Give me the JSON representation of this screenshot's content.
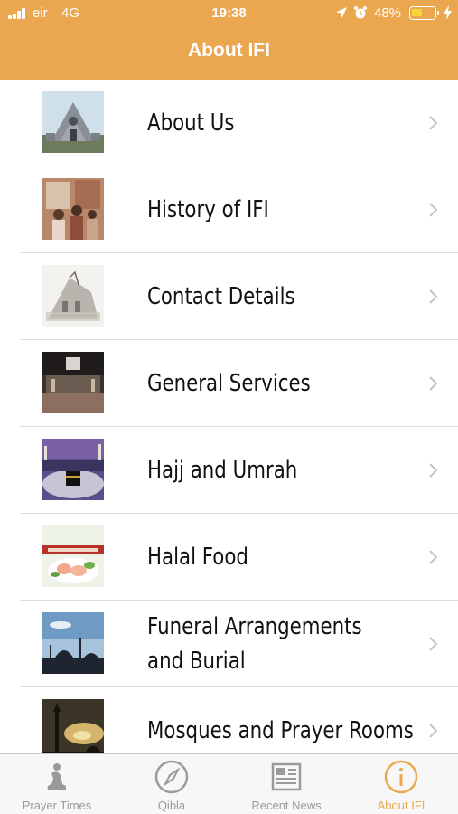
{
  "status_bar": {
    "carrier": "eir",
    "network": "4G",
    "time": "19:38",
    "battery_percent": "48%",
    "battery_level": 0.48,
    "icons": [
      "signal-icon",
      "location-icon",
      "alarm-icon",
      "battery-icon",
      "charging-icon"
    ]
  },
  "nav": {
    "title": "About IFI"
  },
  "colors": {
    "accent": "#eba74f",
    "tab_inactive": "#9a9a9a"
  },
  "list": {
    "items": [
      {
        "label": "About Us",
        "thumb": "church-facade"
      },
      {
        "label": "History of IFI",
        "thumb": "family-photo"
      },
      {
        "label": "Contact Details",
        "thumb": "building-sketch"
      },
      {
        "label": "General Services",
        "thumb": "prayer-hall"
      },
      {
        "label": "Hajj and Umrah",
        "thumb": "kaaba"
      },
      {
        "label": "Halal Food",
        "thumb": "halal-food"
      },
      {
        "label": "Funeral Arrangements and Burial",
        "thumb": "mosque-silhouette"
      },
      {
        "label": "Mosques and Prayer Rooms",
        "thumb": "minaret-sunset"
      }
    ]
  },
  "tab_bar": {
    "tabs": [
      {
        "label": "Prayer Times",
        "icon": "praying-person-icon",
        "active": false
      },
      {
        "label": "Qibla",
        "icon": "compass-icon",
        "active": false
      },
      {
        "label": "Recent News",
        "icon": "newspaper-icon",
        "active": false
      },
      {
        "label": "About IFI",
        "icon": "info-icon",
        "active": true
      }
    ]
  }
}
